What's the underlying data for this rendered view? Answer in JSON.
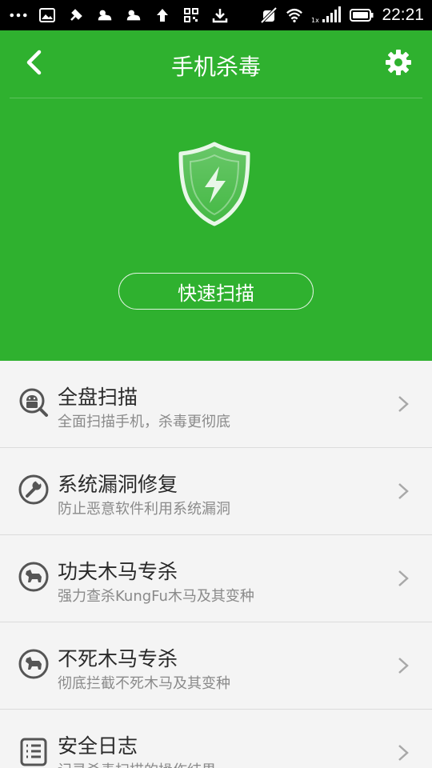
{
  "status_bar": {
    "time": "22:21",
    "left_icons": [
      "more-dots-icon",
      "image-icon",
      "tool-icon",
      "weather-icon",
      "weather-icon-2",
      "upload-icon",
      "qr-icon",
      "download-icon"
    ],
    "right_icons": [
      "mute-icon",
      "wifi-icon",
      "signal-icon",
      "battery-icon"
    ]
  },
  "header": {
    "title": "手机杀毒"
  },
  "hero": {
    "scan_button_label": "快速扫描"
  },
  "colors": {
    "brand_green": "#2fb12f",
    "list_bg": "#f4f4f4",
    "title_text": "#2a2a2a",
    "sub_text": "#8a8a8a"
  },
  "items": [
    {
      "icon": "android-search-icon",
      "title": "全盘扫描",
      "subtitle": "全面扫描手机，杀毒更彻底"
    },
    {
      "icon": "wrench-icon",
      "title": "系统漏洞修复",
      "subtitle": "防止恶意软件利用系统漏洞"
    },
    {
      "icon": "horse-icon",
      "title": "功夫木马专杀",
      "subtitle": "强力查杀KungFu木马及其变种"
    },
    {
      "icon": "horse-icon",
      "title": "不死木马专杀",
      "subtitle": "彻底拦截不死木马及其变种"
    },
    {
      "icon": "log-icon",
      "title": "安全日志",
      "subtitle": "记录杀毒扫描的操作结果"
    }
  ]
}
